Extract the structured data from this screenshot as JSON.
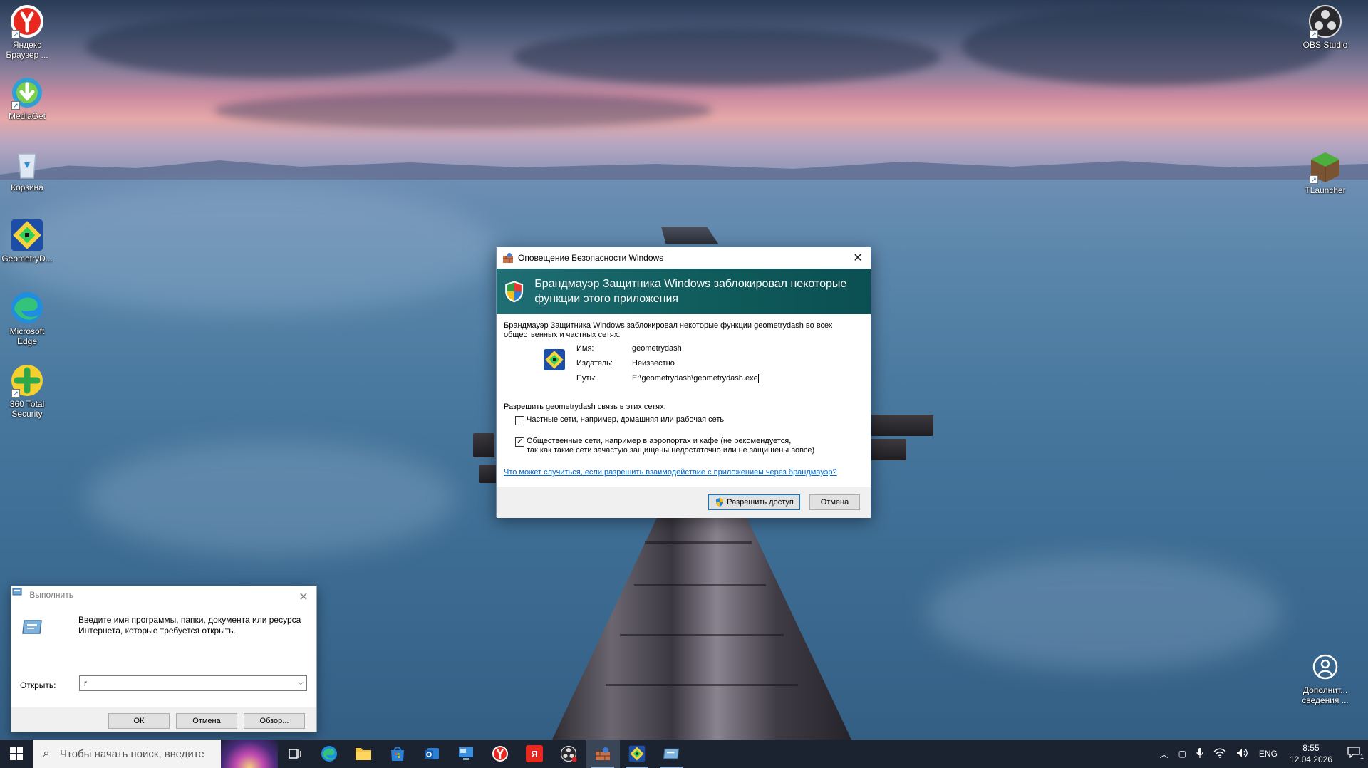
{
  "desktop": {
    "icons": [
      {
        "label": "Яндекс Браузер ...",
        "icon": "yandex-browser-icon"
      },
      {
        "label": "MediaGet",
        "icon": "mediaget-icon"
      },
      {
        "label": "Корзина",
        "icon": "recycle-bin-icon"
      },
      {
        "label": "GeometryD...",
        "icon": "geometry-dash-icon"
      },
      {
        "label": "Microsoft Edge",
        "icon": "edge-icon"
      },
      {
        "label": "360 Total Security",
        "icon": "360-security-icon"
      },
      {
        "label": "OBS Studio",
        "icon": "obs-icon"
      },
      {
        "label": "TLauncher",
        "icon": "tlauncher-icon"
      },
      {
        "label": "Дополнит... сведения ...",
        "icon": "info-icon"
      }
    ]
  },
  "security_dialog": {
    "title": "Оповещение Безопасности Windows",
    "banner": "Брандмауэр Защитника Windows заблокировал некоторые функции этого приложения",
    "description": "Брандмауэр Защитника Windows заблокировал некоторые функции geometrydash во всех общественных и частных сетях.",
    "fields": {
      "name_label": "Имя:",
      "name_value": "geometrydash",
      "publisher_label": "Издатель:",
      "publisher_value": "Неизвестно",
      "path_label": "Путь:",
      "path_value": "E:\\geometrydash\\geometrydash.exe"
    },
    "allow_title": "Разрешить geometrydash связь в этих сетях:",
    "private_networks": {
      "label": "Частные сети, например, домашняя или рабочая сеть",
      "checked": false
    },
    "public_networks": {
      "label_line1": "Общественные сети, например в аэропортах и кафе (не рекомендуется,",
      "label_line2": "так как такие сети зачастую защищены недостаточно или не защищены вовсе)",
      "checked": true
    },
    "link": "Что может случиться, если разрешить взаимодействие с приложением через брандмауэр?",
    "allow_button": "Разрешить доступ",
    "cancel_button": "Отмена"
  },
  "run_dialog": {
    "title": "Выполнить",
    "description": "Введите имя программы, папки, документа или ресурса Интернета, которые требуется открыть.",
    "open_label": "Открыть:",
    "input_value": "r",
    "ok_button": "ОК",
    "cancel_button": "Отмена",
    "browse_button": "Обзор..."
  },
  "taskbar": {
    "search_placeholder": "Чтобы начать поиск, введите",
    "language": "ENG",
    "time": "8:55",
    "date": "12.04.2026",
    "notification_count": "1",
    "apps": [
      "task-view",
      "edge",
      "file-explorer",
      "store",
      "outlook",
      "remote-desktop",
      "yandex-browser",
      "yandex",
      "obs",
      "security-alert",
      "geometry-dash",
      "run"
    ]
  },
  "colors": {
    "banner": "#0f5a5a",
    "link": "#0066cc",
    "taskbar": "#1b2330"
  }
}
